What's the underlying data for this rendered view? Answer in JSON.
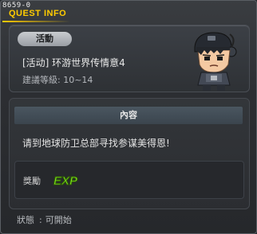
{
  "window": {
    "quest_id": "8659-0",
    "title": "QUEST INFO"
  },
  "quest": {
    "category": "活動",
    "name": "[活动] 环游世界传情意4",
    "level_label": "建議等級",
    "level_range": "10~14"
  },
  "content": {
    "header": "內容",
    "text": "请到地球防卫总部寻找参谋美得恩!"
  },
  "reward": {
    "label": "獎勵",
    "exp_icon_text": "EXP"
  },
  "status": {
    "label": "狀態",
    "value": "可開始"
  },
  "colors": {
    "title": "#ffcc00",
    "exp_green": "#7fe81c"
  },
  "icons": {
    "npc": "npc-character-portrait",
    "exp": "exp-icon"
  }
}
